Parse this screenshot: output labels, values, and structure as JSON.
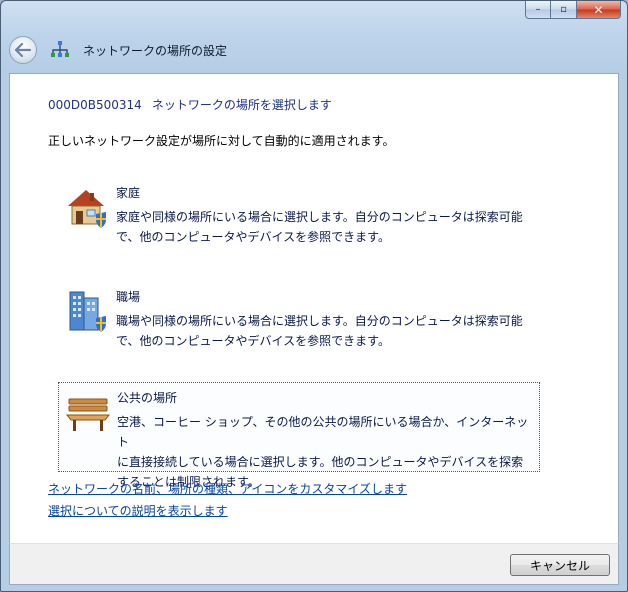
{
  "window": {
    "title": "ネットワークの場所の設定",
    "controls": {
      "minimize": "–",
      "maximize": "▫",
      "close": "✕"
    }
  },
  "main": {
    "heading_id": "000D0B500314",
    "heading_text": "ネットワークの場所を選択します",
    "description": "正しいネットワーク設定が場所に対して自動的に適用されます。",
    "options": [
      {
        "title": "家庭",
        "line1": "家庭や同様の場所にいる場合に選択します。自分のコンピュータは探索可能",
        "line2": "で、他のコンピュータやデバイスを参照できます。",
        "icon": "home-icon"
      },
      {
        "title": "職場",
        "line1": "職場や同様の場所にいる場合に選択します。自分のコンピュータは探索可能",
        "line2": "で、他のコンピュータやデバイスを参照できます。",
        "icon": "office-building-icon"
      },
      {
        "title": "公共の場所",
        "line1": "空港、コーヒー ショップ、その他の公共の場所にいる場合か、インターネット",
        "line2": "に直接接続している場合に選択します。他のコンピュータやデバイスを探索",
        "line3": "することは制限されます。",
        "icon": "park-bench-icon"
      }
    ],
    "links": {
      "customize": "ネットワークの名前、場所の種類、アイコンをカスタマイズします",
      "explain": "選択についての説明を表示します"
    }
  },
  "footer": {
    "cancel_label": "キャンセル"
  }
}
